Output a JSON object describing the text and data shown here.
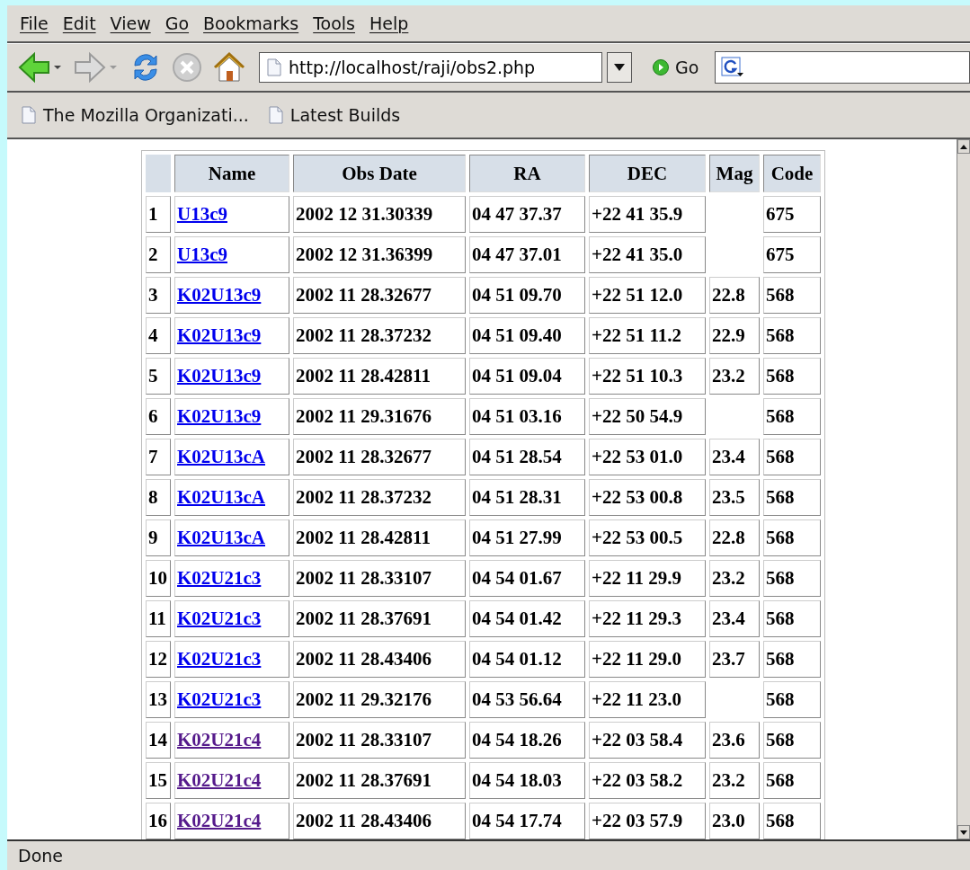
{
  "menu": [
    "File",
    "Edit",
    "View",
    "Go",
    "Bookmarks",
    "Tools",
    "Help"
  ],
  "toolbar": {
    "url": "http://localhost/raji/obs2.php",
    "go": "Go"
  },
  "bookmarks": [
    "The Mozilla Organizati...",
    "Latest Builds"
  ],
  "table": {
    "columns": [
      "Name",
      "Obs Date",
      "RA",
      "DEC",
      "Mag",
      "Code"
    ],
    "rows": [
      {
        "n": "1",
        "name": "U13c9",
        "visited": false,
        "date": "2002 12 31.30339",
        "ra": "04 47 37.37",
        "dec": "+22 41 35.9",
        "code": "675"
      },
      {
        "n": "2",
        "name": "U13c9",
        "visited": false,
        "date": "2002 12 31.36399",
        "ra": "04 47 37.01",
        "dec": "+22 41 35.0",
        "code": "675"
      },
      {
        "n": "3",
        "name": "K02U13c9",
        "visited": false,
        "date": "2002 11 28.32677",
        "ra": "04 51 09.70",
        "dec": "+22 51 12.0",
        "mag": "22.8",
        "code": "568"
      },
      {
        "n": "4",
        "name": "K02U13c9",
        "visited": false,
        "date": "2002 11 28.37232",
        "ra": "04 51 09.40",
        "dec": "+22 51 11.2",
        "mag": "22.9",
        "code": "568"
      },
      {
        "n": "5",
        "name": "K02U13c9",
        "visited": false,
        "date": "2002 11 28.42811",
        "ra": "04 51 09.04",
        "dec": "+22 51 10.3",
        "mag": "23.2",
        "code": "568"
      },
      {
        "n": "6",
        "name": "K02U13c9",
        "visited": false,
        "date": "2002 11 29.31676",
        "ra": "04 51 03.16",
        "dec": "+22 50 54.9",
        "code": "568"
      },
      {
        "n": "7",
        "name": "K02U13cA",
        "visited": false,
        "date": "2002 11 28.32677",
        "ra": "04 51 28.54",
        "dec": "+22 53 01.0",
        "mag": "23.4",
        "code": "568"
      },
      {
        "n": "8",
        "name": "K02U13cA",
        "visited": false,
        "date": "2002 11 28.37232",
        "ra": "04 51 28.31",
        "dec": "+22 53 00.8",
        "mag": "23.5",
        "code": "568"
      },
      {
        "n": "9",
        "name": "K02U13cA",
        "visited": false,
        "date": "2002 11 28.42811",
        "ra": "04 51 27.99",
        "dec": "+22 53 00.5",
        "mag": "22.8",
        "code": "568"
      },
      {
        "n": "10",
        "name": "K02U21c3",
        "visited": false,
        "date": "2002 11 28.33107",
        "ra": "04 54 01.67",
        "dec": "+22 11 29.9",
        "mag": "23.2",
        "code": "568"
      },
      {
        "n": "11",
        "name": "K02U21c3",
        "visited": false,
        "date": "2002 11 28.37691",
        "ra": "04 54 01.42",
        "dec": "+22 11 29.3",
        "mag": "23.4",
        "code": "568"
      },
      {
        "n": "12",
        "name": "K02U21c3",
        "visited": false,
        "date": "2002 11 28.43406",
        "ra": "04 54 01.12",
        "dec": "+22 11 29.0",
        "mag": "23.7",
        "code": "568"
      },
      {
        "n": "13",
        "name": "K02U21c3",
        "visited": false,
        "date": "2002 11 29.32176",
        "ra": "04 53 56.64",
        "dec": "+22 11 23.0",
        "code": "568"
      },
      {
        "n": "14",
        "name": "K02U21c4",
        "visited": true,
        "date": "2002 11 28.33107",
        "ra": "04 54 18.26",
        "dec": "+22 03 58.4",
        "mag": "23.6",
        "code": "568"
      },
      {
        "n": "15",
        "name": "K02U21c4",
        "visited": true,
        "date": "2002 11 28.37691",
        "ra": "04 54 18.03",
        "dec": "+22 03 58.2",
        "mag": "23.2",
        "code": "568"
      },
      {
        "n": "16",
        "name": "K02U21c4",
        "visited": true,
        "date": "2002 11 28.43406",
        "ra": "04 54 17.74",
        "dec": "+22 03 57.9",
        "mag": "23.0",
        "code": "568"
      }
    ]
  },
  "status": "Done"
}
